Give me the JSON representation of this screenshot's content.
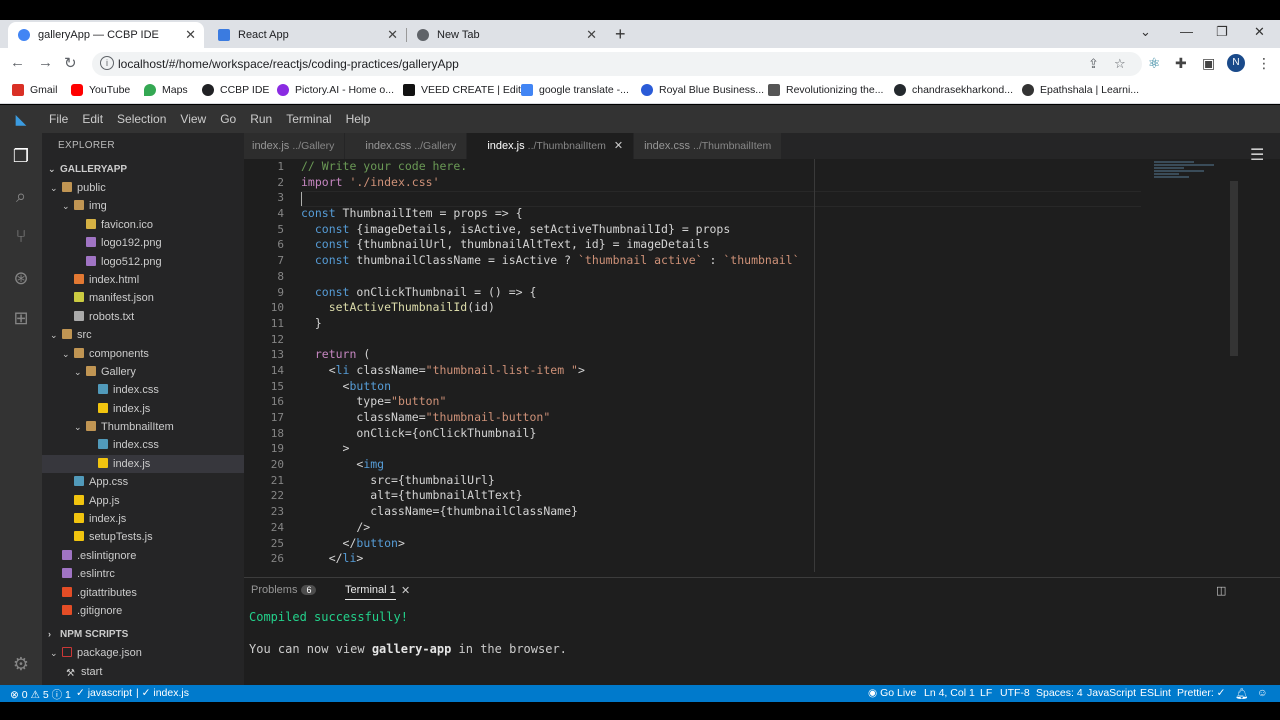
{
  "browser": {
    "tabs": [
      {
        "title": "galleryApp — CCBP IDE",
        "active": true,
        "favicon_color": "#4285f4"
      },
      {
        "title": "React App",
        "active": false,
        "favicon_color": "#3b7be0"
      },
      {
        "title": "New Tab",
        "active": false,
        "favicon_color": "#5f6368"
      }
    ],
    "url": "localhost/#/home/workspace/reactjs/coding-practices/galleryApp",
    "avatar_letter": "N",
    "bookmarks": [
      {
        "label": "Gmail",
        "color": "#d93025"
      },
      {
        "label": "YouTube",
        "color": "#ff0000"
      },
      {
        "label": "Maps",
        "color": "#34a853"
      },
      {
        "label": "CCBP IDE",
        "color": "#202124"
      },
      {
        "label": "Pictory.AI - Home o...",
        "color": "#8a2be2"
      },
      {
        "label": "VEED CREATE | Edit",
        "color": "#111111"
      },
      {
        "label": "google translate -...",
        "color": "#4285f4"
      },
      {
        "label": "Royal Blue Business...",
        "color": "#2a5bd7"
      },
      {
        "label": "Revolutionizing the...",
        "color": "#555555"
      },
      {
        "label": "chandrasekharkond...",
        "color": "#24292e"
      },
      {
        "label": "Epathshala | Learni...",
        "color": "#333333"
      }
    ]
  },
  "ide": {
    "menu": [
      "File",
      "Edit",
      "Selection",
      "View",
      "Go",
      "Run",
      "Terminal",
      "Help"
    ],
    "explorer_title": "EXPLORER",
    "project": "GALLERYAPP",
    "tree": [
      {
        "label": "public",
        "depth": 0,
        "type": "folder-open"
      },
      {
        "label": "img",
        "depth": 1,
        "type": "folder-open"
      },
      {
        "label": "favicon.ico",
        "depth": 2,
        "type": "ico"
      },
      {
        "label": "logo192.png",
        "depth": 2,
        "type": "png"
      },
      {
        "label": "logo512.png",
        "depth": 2,
        "type": "png"
      },
      {
        "label": "index.html",
        "depth": 1,
        "type": "html"
      },
      {
        "label": "manifest.json",
        "depth": 1,
        "type": "json"
      },
      {
        "label": "robots.txt",
        "depth": 1,
        "type": "txt"
      },
      {
        "label": "src",
        "depth": 0,
        "type": "folder-open"
      },
      {
        "label": "components",
        "depth": 1,
        "type": "folder-open"
      },
      {
        "label": "Gallery",
        "depth": 2,
        "type": "folder-open"
      },
      {
        "label": "index.css",
        "depth": 3,
        "type": "css"
      },
      {
        "label": "index.js",
        "depth": 3,
        "type": "js"
      },
      {
        "label": "ThumbnailItem",
        "depth": 2,
        "type": "folder-open"
      },
      {
        "label": "index.css",
        "depth": 3,
        "type": "css"
      },
      {
        "label": "index.js",
        "depth": 3,
        "type": "js",
        "selected": true
      },
      {
        "label": "App.css",
        "depth": 1,
        "type": "css"
      },
      {
        "label": "App.js",
        "depth": 1,
        "type": "js"
      },
      {
        "label": "index.js",
        "depth": 1,
        "type": "js"
      },
      {
        "label": "setupTests.js",
        "depth": 1,
        "type": "js"
      },
      {
        "label": ".eslintignore",
        "depth": 0,
        "type": "cfg"
      },
      {
        "label": ".eslintrc",
        "depth": 0,
        "type": "cfg"
      },
      {
        "label": ".gitattributes",
        "depth": 0,
        "type": "git"
      },
      {
        "label": ".gitignore",
        "depth": 0,
        "type": "git"
      }
    ],
    "npm_scripts_title": "NPM SCRIPTS",
    "npm_package": "package.json",
    "npm_script": "start",
    "editor_tabs": [
      {
        "name": "index.js",
        "dir": "../Gallery",
        "active": false
      },
      {
        "name": "index.css",
        "dir": "../Gallery",
        "active": false
      },
      {
        "name": "index.js",
        "dir": "../ThumbnailItem",
        "active": true
      },
      {
        "name": "index.css",
        "dir": "../ThumbnailItem",
        "active": false
      }
    ],
    "code": [
      "// Write your code here.",
      "import './index.css'",
      "",
      "const ThumbnailItem = props => {",
      "  const {imageDetails, isActive, setActiveThumbnailId} = props",
      "  const {thumbnailUrl, thumbnailAltText, id} = imageDetails",
      "  const thumbnailClassName = isActive ? `thumbnail active` : `thumbnail`",
      "",
      "  const onClickThumbnail = () => {",
      "    setActiveThumbnailId(id)",
      "  }",
      "",
      "  return (",
      "    <li className=\"thumbnail-list-item \">",
      "      <button",
      "        type=\"button\"",
      "        className=\"thumbnail-button\"",
      "        onClick={onClickThumbnail}",
      "      >",
      "        <img",
      "          src={thumbnailUrl}",
      "          alt={thumbnailAltText}",
      "          className={thumbnailClassName}",
      "        />",
      "      </button>",
      "    </li>"
    ],
    "panel": {
      "problems_label": "Problems",
      "problems_count": "6",
      "terminal_label": "Terminal 1",
      "line1": "Compiled successfully!",
      "line2_pre": "You can now view ",
      "line2_app": "gallery-app",
      "line2_post": " in the browser."
    },
    "status": {
      "errors": "0",
      "warnings": "5",
      "infos": "1",
      "language_check": "javascript",
      "file_check": "index.js",
      "go_live": "Go Live",
      "position": "Ln 4, Col 1",
      "eol": "LF",
      "encoding": "UTF-8",
      "spaces": "Spaces: 4",
      "language": "JavaScript",
      "eslint": "ESLint",
      "prettier": "Prettier: ✓"
    }
  }
}
